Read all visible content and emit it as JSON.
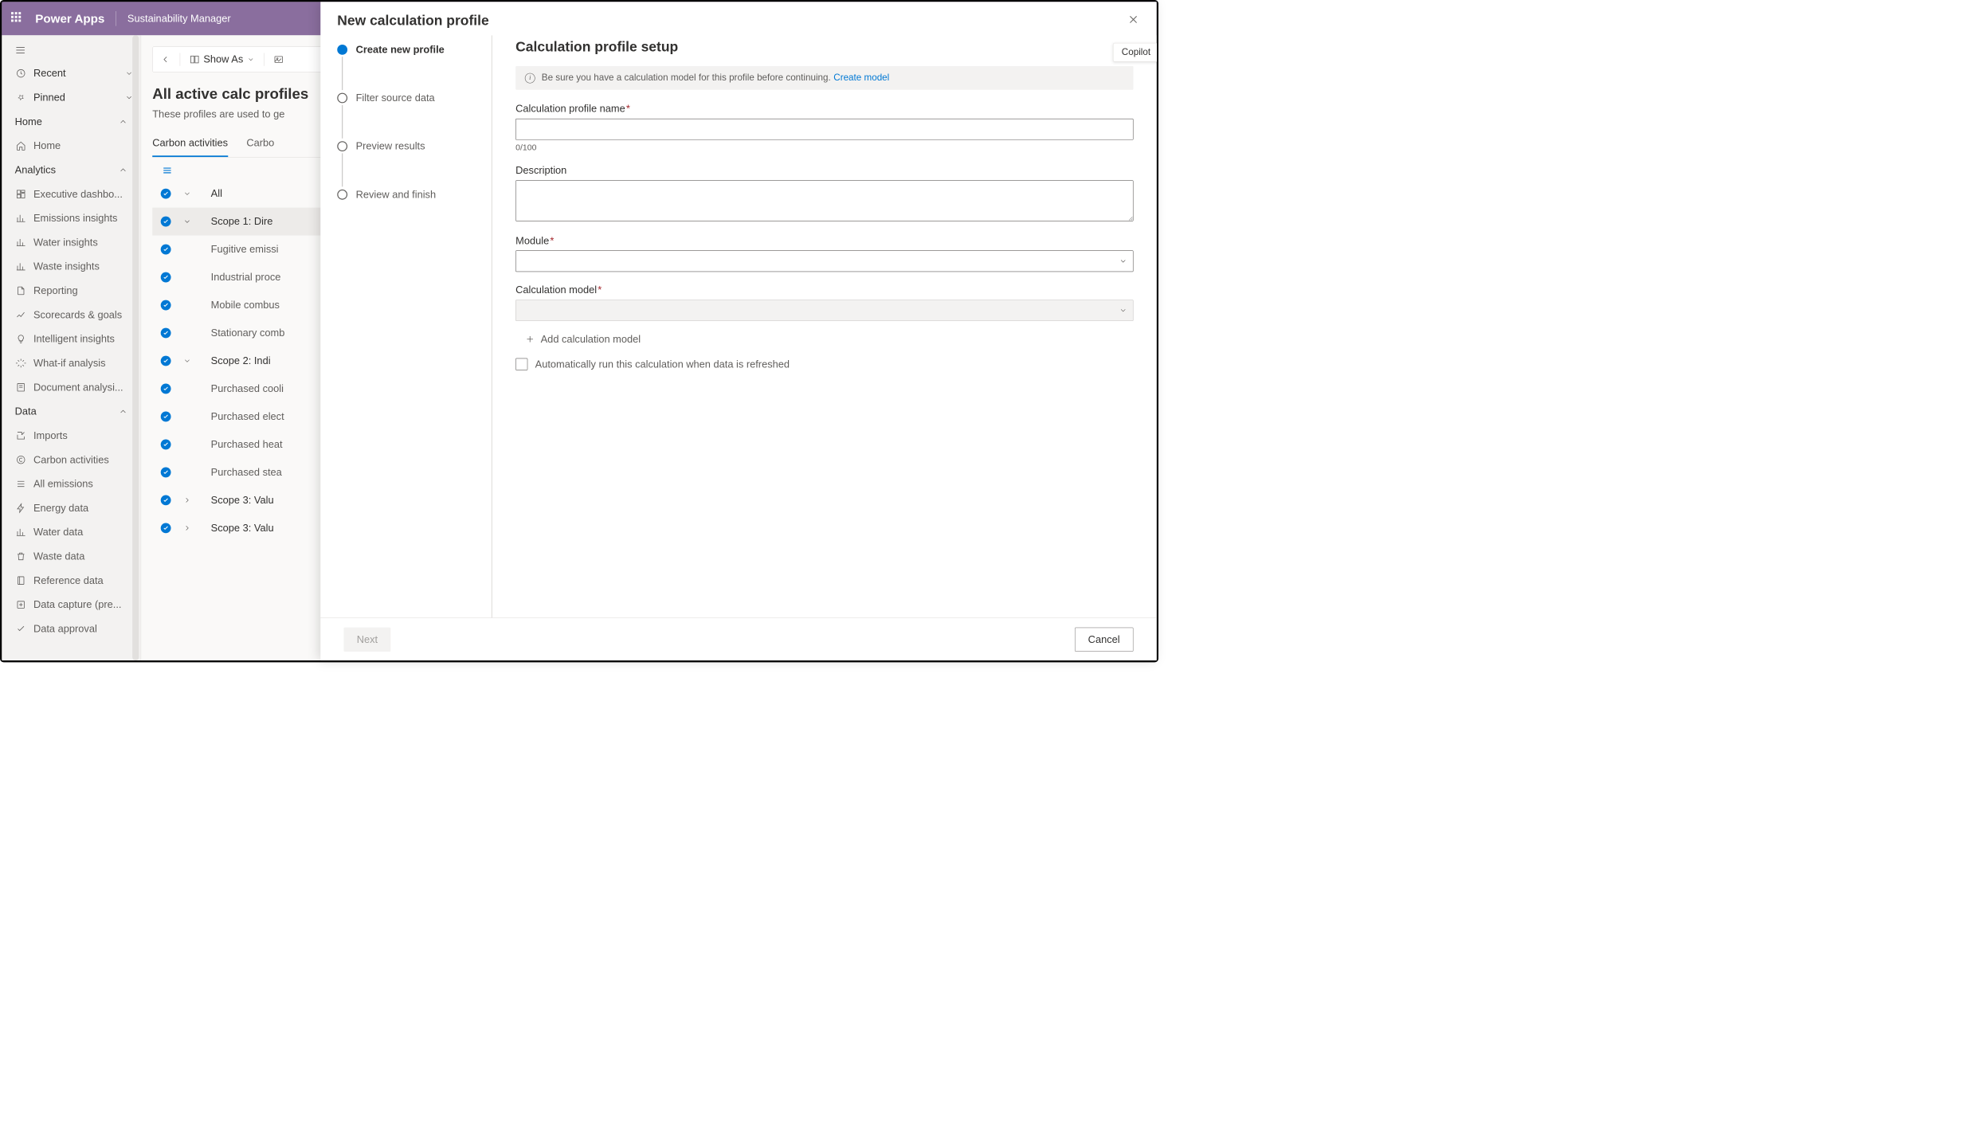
{
  "header": {
    "app": "Power Apps",
    "env": "Sustainability Manager"
  },
  "sidebar": {
    "recent": "Recent",
    "pinned": "Pinned",
    "sections": {
      "home": {
        "label": "Home",
        "items": [
          "Home"
        ]
      },
      "analytics": {
        "label": "Analytics",
        "items": [
          "Executive dashbo...",
          "Emissions insights",
          "Water insights",
          "Waste insights",
          "Reporting",
          "Scorecards & goals",
          "Intelligent insights",
          "What-if analysis",
          "Document analysi..."
        ]
      },
      "data": {
        "label": "Data",
        "items": [
          "Imports",
          "Carbon activities",
          "All emissions",
          "Energy data",
          "Water data",
          "Waste data",
          "Reference data",
          "Data capture (pre...",
          "Data approval"
        ]
      }
    }
  },
  "toolbar": {
    "back": "",
    "showAs": "Show As"
  },
  "page": {
    "title": "All active calc profiles",
    "subtitle": "These profiles are used to ge",
    "tabs": [
      "Carbon activities",
      "Carbo"
    ],
    "rows": [
      {
        "label": "All",
        "type": "group",
        "expanded": true
      },
      {
        "label": "Scope 1: Dire",
        "type": "group",
        "expanded": true,
        "selected": true
      },
      {
        "label": "Fugitive emissi",
        "type": "child"
      },
      {
        "label": "Industrial proce",
        "type": "child"
      },
      {
        "label": "Mobile combus",
        "type": "child"
      },
      {
        "label": "Stationary comb",
        "type": "child"
      },
      {
        "label": "Scope 2: Indi",
        "type": "group",
        "expanded": true
      },
      {
        "label": "Purchased cooli",
        "type": "child"
      },
      {
        "label": "Purchased elect",
        "type": "child"
      },
      {
        "label": "Purchased heat",
        "type": "child"
      },
      {
        "label": "Purchased stea",
        "type": "child"
      },
      {
        "label": "Scope 3: Valu",
        "type": "group",
        "expanded": false
      },
      {
        "label": "Scope 3: Valu",
        "type": "group",
        "expanded": false
      }
    ]
  },
  "panel": {
    "title": "New calculation profile",
    "copilot": "Copilot",
    "steps": [
      "Create new profile",
      "Filter source data",
      "Preview results",
      "Review and finish"
    ],
    "formTitle": "Calculation profile setup",
    "info": {
      "text": "Be sure you have a calculation model for this profile before continuing.",
      "link": "Create model"
    },
    "fields": {
      "name": {
        "label": "Calculation profile name",
        "value": "",
        "counter": "0/100"
      },
      "desc": {
        "label": "Description",
        "value": ""
      },
      "module": {
        "label": "Module",
        "value": ""
      },
      "model": {
        "label": "Calculation model",
        "value": ""
      },
      "addModel": "Add calculation model",
      "autoRun": "Automatically run this calculation when data is refreshed"
    },
    "footer": {
      "next": "Next",
      "cancel": "Cancel"
    }
  }
}
